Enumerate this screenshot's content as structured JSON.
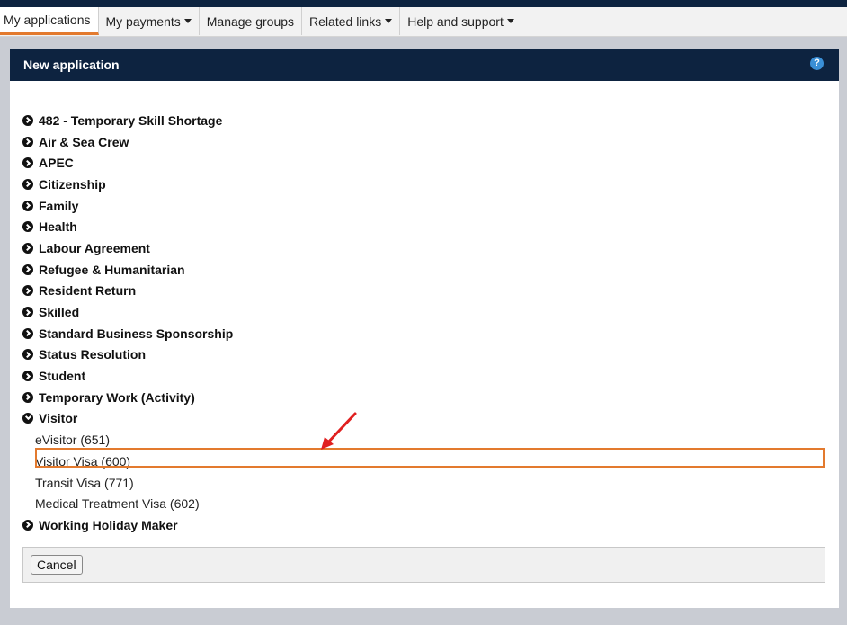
{
  "menu": {
    "items": [
      {
        "label": "My applications",
        "active": true,
        "dropdown": false
      },
      {
        "label": "My payments",
        "active": false,
        "dropdown": true
      },
      {
        "label": "Manage groups",
        "active": false,
        "dropdown": false
      },
      {
        "label": "Related links",
        "active": false,
        "dropdown": true
      },
      {
        "label": "Help and support",
        "active": false,
        "dropdown": true
      }
    ]
  },
  "panel": {
    "title": "New application",
    "help_icon": "?",
    "categories": [
      {
        "label": "482 - Temporary Skill Shortage",
        "expanded": false
      },
      {
        "label": "Air & Sea Crew",
        "expanded": false
      },
      {
        "label": "APEC",
        "expanded": false
      },
      {
        "label": "Citizenship",
        "expanded": false
      },
      {
        "label": "Family",
        "expanded": false
      },
      {
        "label": "Health",
        "expanded": false
      },
      {
        "label": "Labour Agreement",
        "expanded": false
      },
      {
        "label": "Refugee & Humanitarian",
        "expanded": false
      },
      {
        "label": "Resident Return",
        "expanded": false
      },
      {
        "label": "Skilled",
        "expanded": false
      },
      {
        "label": "Standard Business Sponsorship",
        "expanded": false
      },
      {
        "label": "Status Resolution",
        "expanded": false
      },
      {
        "label": "Student",
        "expanded": false
      },
      {
        "label": "Temporary Work (Activity)",
        "expanded": false
      },
      {
        "label": "Visitor",
        "expanded": true
      },
      {
        "label": "Working Holiday Maker",
        "expanded": false
      }
    ],
    "visitor_options": [
      {
        "label": "eVisitor (651)"
      },
      {
        "label": "Visitor Visa (600)",
        "selected": true
      },
      {
        "label": "Transit Visa (771)"
      },
      {
        "label": "Medical Treatment Visa (602)"
      }
    ],
    "cancel_label": "Cancel"
  },
  "colors": {
    "header_bg": "#0d2340",
    "accent": "#e37a2e",
    "annotation_arrow": "#e02020"
  }
}
